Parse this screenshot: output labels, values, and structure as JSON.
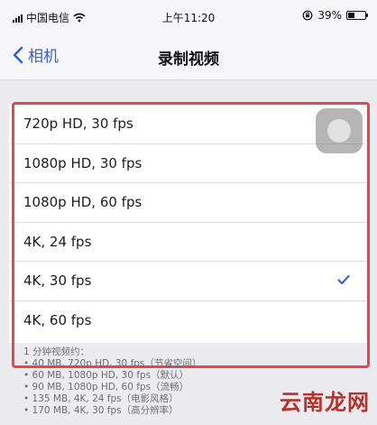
{
  "status_bar": {
    "carrier": "中国电信",
    "time": "上午11:20",
    "battery": "39%",
    "battery_level": 0.39
  },
  "nav": {
    "back_label": "相机",
    "title": "录制视频"
  },
  "options": [
    {
      "label": "720p HD, 30 fps",
      "selected": false
    },
    {
      "label": "1080p HD, 30 fps",
      "selected": false
    },
    {
      "label": "1080p HD, 60 fps",
      "selected": false
    },
    {
      "label": "4K, 24 fps",
      "selected": false
    },
    {
      "label": "4K, 30 fps",
      "selected": true
    },
    {
      "label": "4K, 60 fps",
      "selected": false
    }
  ],
  "footer": {
    "heading": "1 分钟视频约：",
    "lines": [
      "• 40 MB, 720p HD, 30 fps（节省空间）",
      "• 60 MB, 1080p HD, 30 fps（默认）",
      "• 90 MB, 1080p HD, 60 fps（流畅）",
      "• 135 MB, 4K, 24 fps（电影风格）",
      "• 170 MB, 4K, 30 fps（高分辨率）"
    ]
  },
  "watermark": "云南龙网",
  "colors": {
    "accent": "#3a62c8",
    "highlight": "#e8454f",
    "watermark": "#b5332b"
  },
  "icons": {
    "back": "chevron-left-icon",
    "check": "checkmark-icon",
    "wifi": "wifi-icon",
    "lock": "rotation-lock-icon",
    "battery": "battery-icon",
    "signal": "signal-icon"
  }
}
